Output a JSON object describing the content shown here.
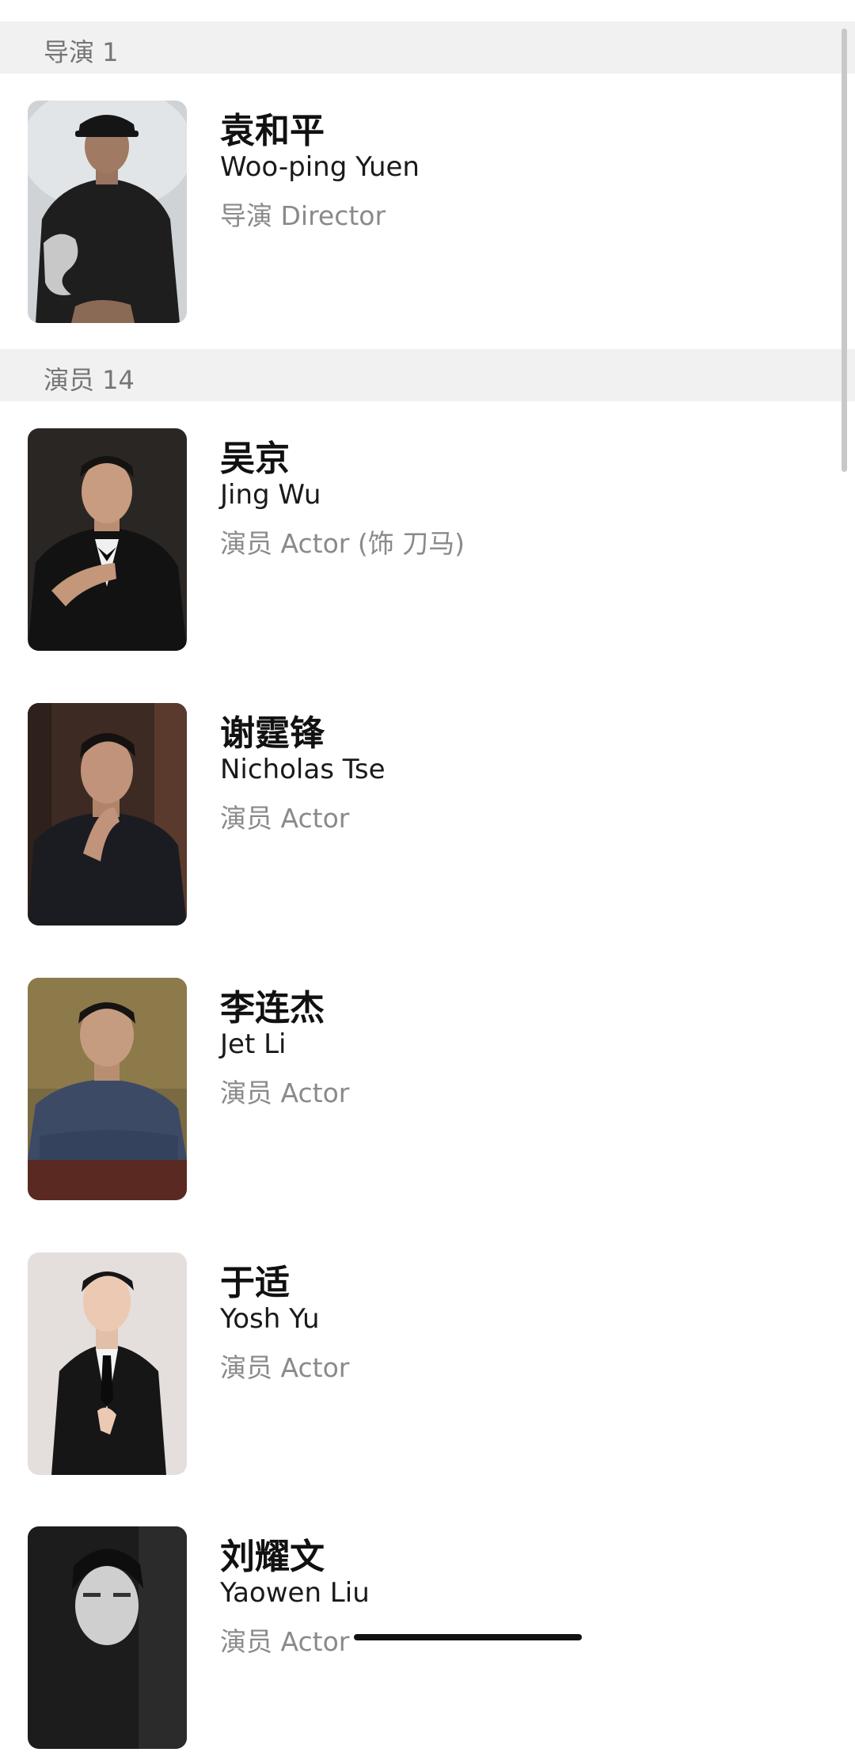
{
  "sections": [
    {
      "header": "导演 1",
      "people": [
        {
          "name_cn": "袁和平",
          "name_en": "Woo-ping Yuen",
          "role": "导演 Director"
        }
      ]
    },
    {
      "header": "演员 14",
      "people": [
        {
          "name_cn": "吴京",
          "name_en": "Jing Wu",
          "role": "演员 Actor (饰 刀马)"
        },
        {
          "name_cn": "谢霆锋",
          "name_en": "Nicholas Tse",
          "role": "演员 Actor"
        },
        {
          "name_cn": "李连杰",
          "name_en": "Jet Li",
          "role": "演员 Actor"
        },
        {
          "name_cn": "于适",
          "name_en": "Yosh Yu",
          "role": "演员 Actor"
        },
        {
          "name_cn": "刘耀文",
          "name_en": "Yaowen Liu",
          "role": "演员 Actor"
        }
      ]
    }
  ],
  "colors": {
    "section_header_bg": "#f1f1f1",
    "section_header_text": "#757575",
    "role_text": "#8a8a8a",
    "name_text": "#111111"
  }
}
